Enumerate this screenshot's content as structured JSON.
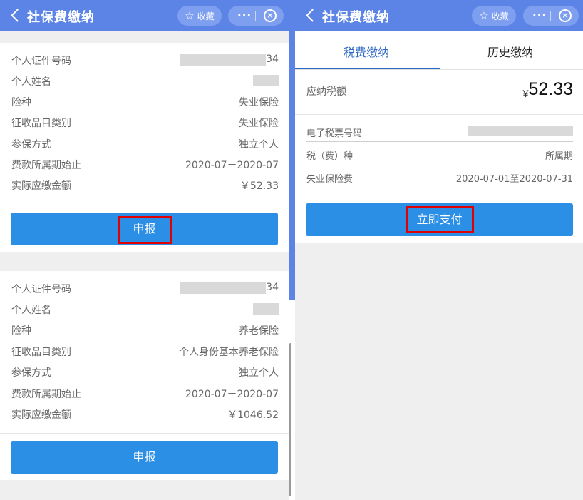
{
  "header": {
    "back_icon": "chevron-left-icon",
    "title": "社保费缴纳",
    "favorite_label": "收藏",
    "favorite_icon": "star-icon",
    "more_icon": "more-dots-icon",
    "close_icon": "close-circle-icon",
    "more_glyph": "···",
    "close_glyph": "×",
    "star_glyph": "☆"
  },
  "left": {
    "cards": [
      {
        "rows": [
          {
            "label": "个人证件号码",
            "value_tail": "34"
          },
          {
            "label": "个人姓名"
          },
          {
            "label": "险种",
            "value": "失业保险"
          },
          {
            "label": "征收品目类别",
            "value": "失业保险"
          },
          {
            "label": "参保方式",
            "value": "独立个人"
          },
          {
            "label": "费款所属期始止",
            "value": "2020-07－2020-07"
          },
          {
            "label": "实际应缴金额",
            "value": "￥52.33"
          }
        ],
        "button_label": "申报"
      },
      {
        "rows": [
          {
            "label": "个人证件号码",
            "value_tail": "34"
          },
          {
            "label": "个人姓名"
          },
          {
            "label": "险种",
            "value": "养老保险"
          },
          {
            "label": "征收品目类别",
            "value": "个人身份基本养老保险"
          },
          {
            "label": "参保方式",
            "value": "独立个人"
          },
          {
            "label": "费款所属期始止",
            "value": "2020-07－2020-07"
          },
          {
            "label": "实际应缴金额",
            "value": "￥1046.52"
          }
        ],
        "button_label": "申报"
      }
    ]
  },
  "right": {
    "tabs": [
      {
        "label": "税费缴纳",
        "active": true
      },
      {
        "label": "历史缴纳",
        "active": false
      }
    ],
    "amount_label": "应纳税额",
    "currency_symbol": "￥",
    "amount_value": "52.33",
    "ticket_label": "电子税票号码",
    "tax_type_label": "税（费）种",
    "period_label": "所属期",
    "item_label": "失业保险费",
    "item_period": "2020-07-01至2020-07-31",
    "pay_button": "立即支付"
  },
  "colors": {
    "header_bg": "#5b84e6",
    "button_bg": "#2b8fe6",
    "highlight": "#e00000",
    "tab_active": "#2b67c4"
  }
}
